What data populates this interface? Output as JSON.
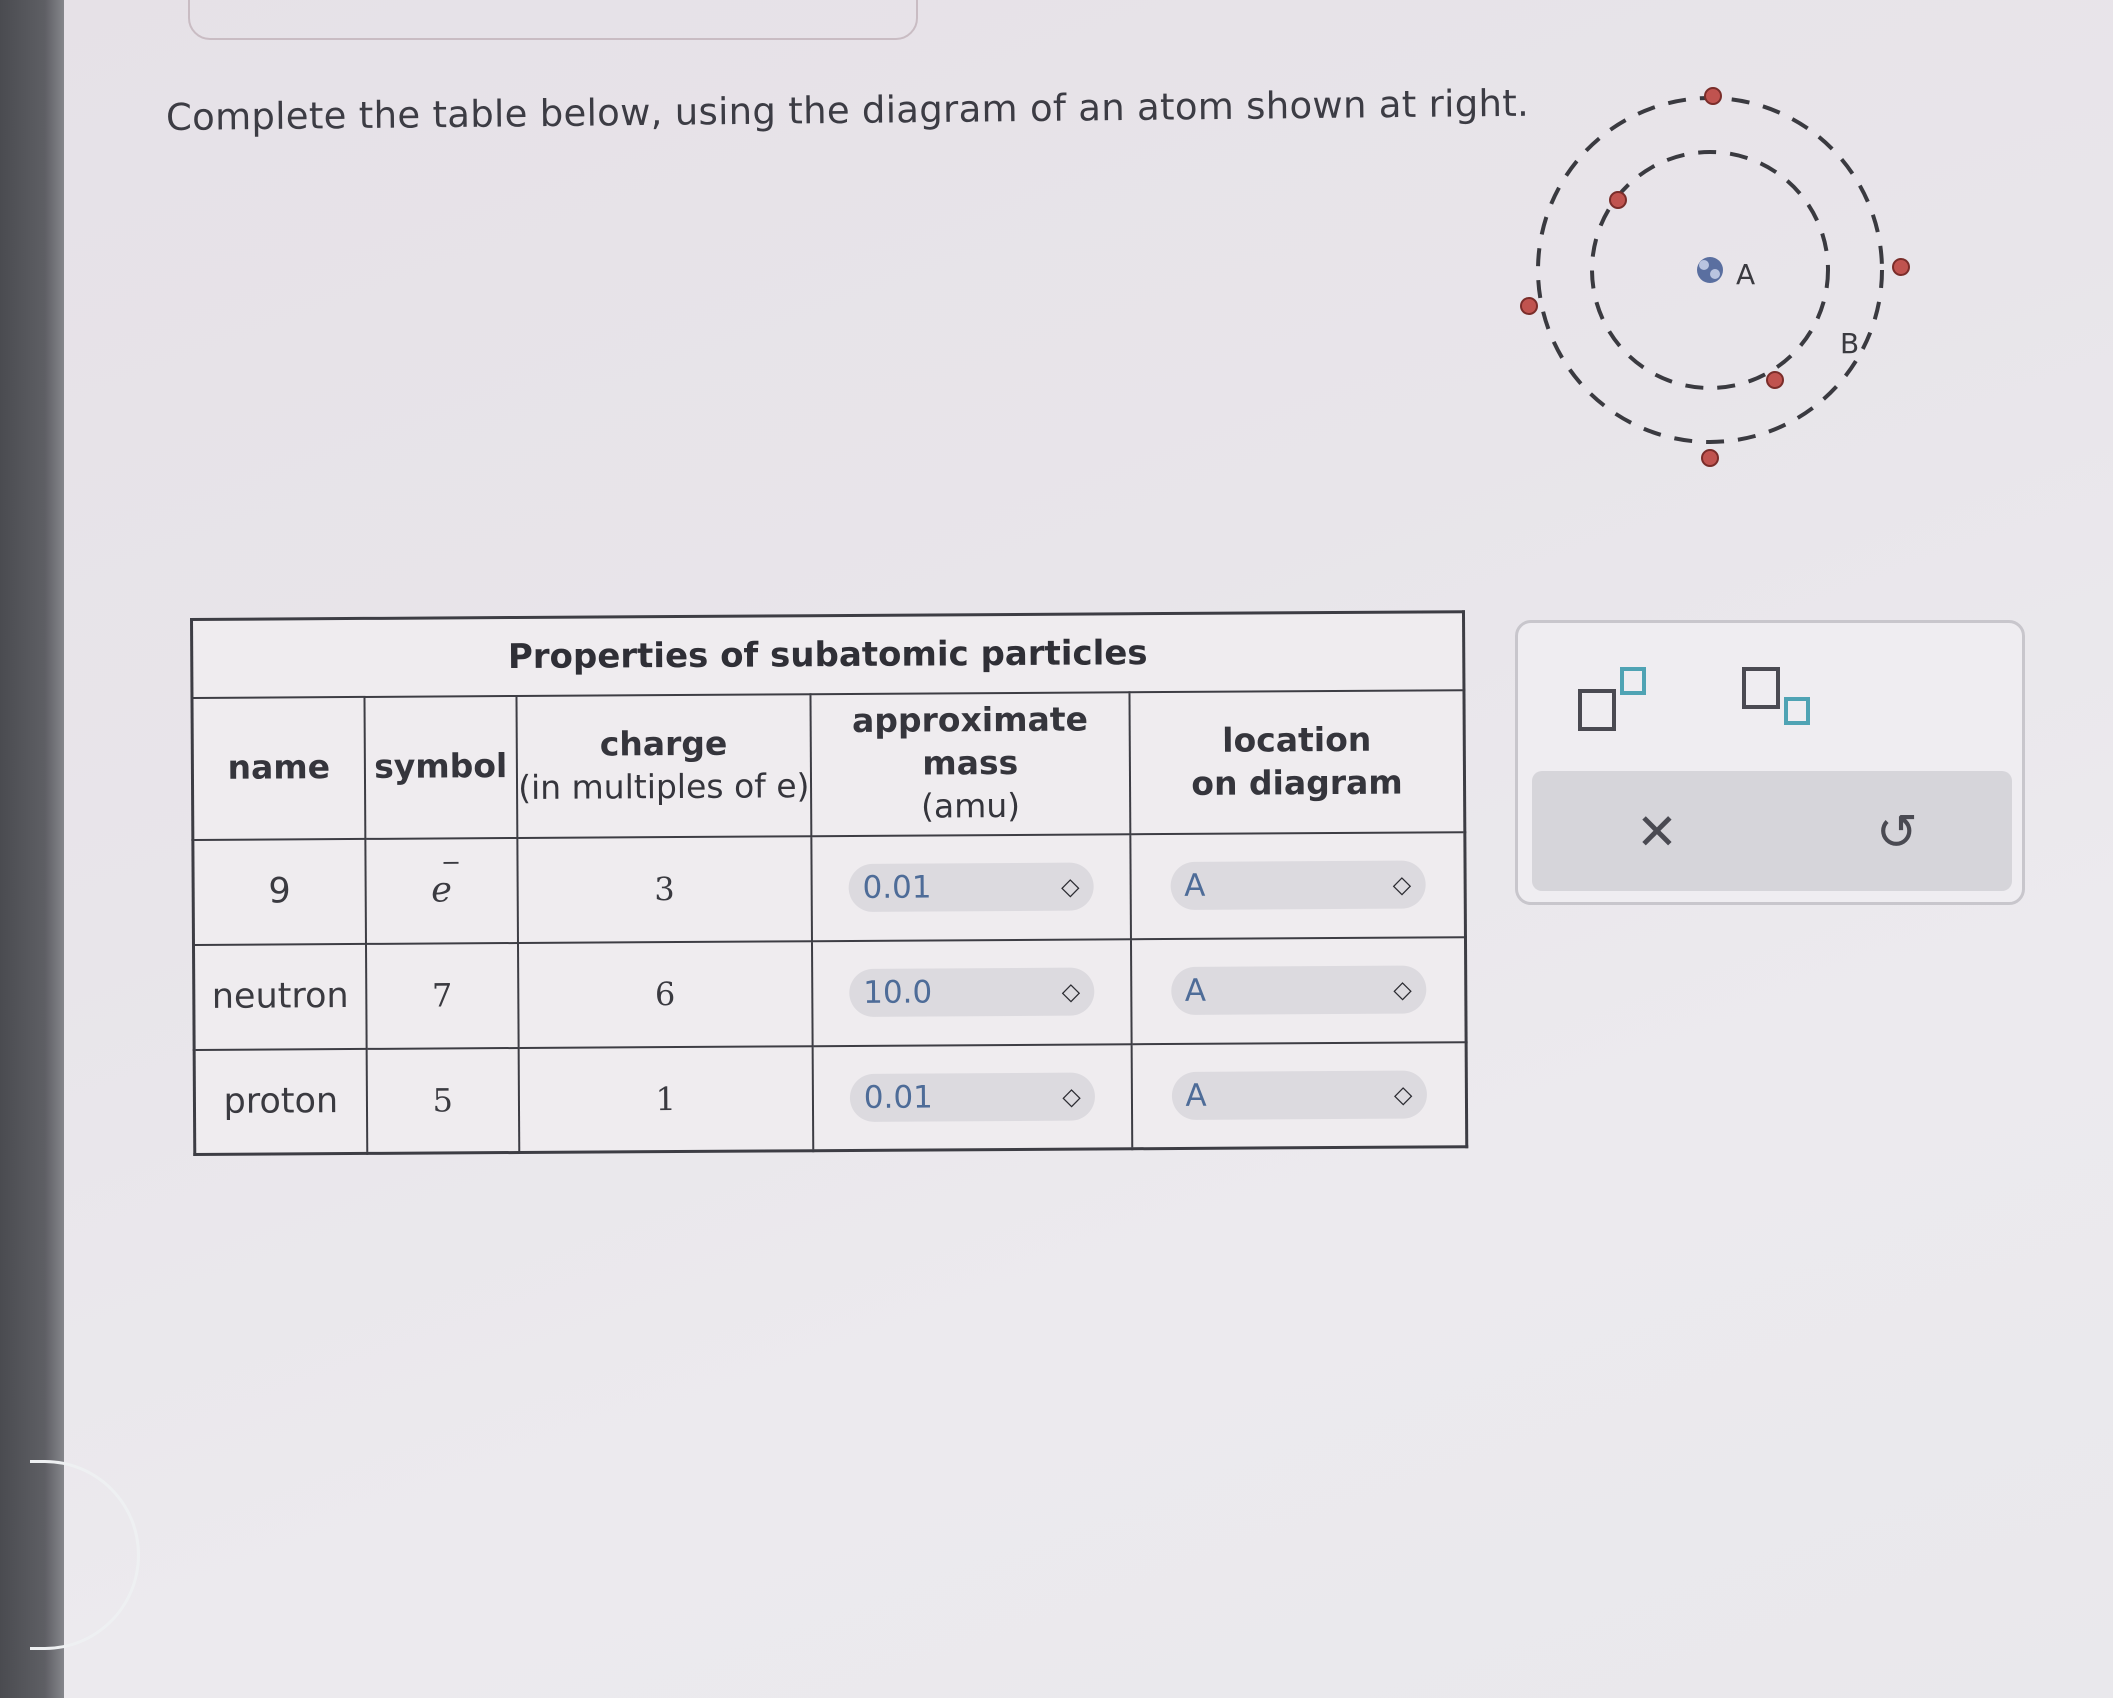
{
  "instruction": "Complete the table below, using the diagram of an atom shown at right.",
  "table": {
    "title": "Properties of subatomic particles",
    "headers": {
      "name": "name",
      "symbol": "symbol",
      "charge": "charge",
      "charge_sub": "(in multiples of e)",
      "mass_line1": "approximate",
      "mass_line2": "mass",
      "mass_sub": "(amu)",
      "location_line1": "location",
      "location_line2": "on diagram"
    },
    "rows": [
      {
        "name": "9",
        "symbol": "e",
        "symbol_sup": "−",
        "charge": "3",
        "mass": "0.01",
        "location": "A"
      },
      {
        "name": "neutron",
        "symbol": "7",
        "charge": "6",
        "mass": "10.0",
        "location": "A"
      },
      {
        "name": "proton",
        "symbol": "5",
        "charge": "1",
        "mass": "0.01",
        "location": "A"
      }
    ]
  },
  "diagram": {
    "label_nucleus": "A",
    "label_orbit": "B"
  },
  "toolbar": {
    "superscript_icon": "superscript-icon",
    "subscript_icon": "subscript-icon",
    "clear_glyph": "✕",
    "undo_glyph": "↺"
  },
  "colors": {
    "select_text": "#4e6c98",
    "electron": "#c0534f",
    "tool_accent": "#4fa3b4"
  }
}
